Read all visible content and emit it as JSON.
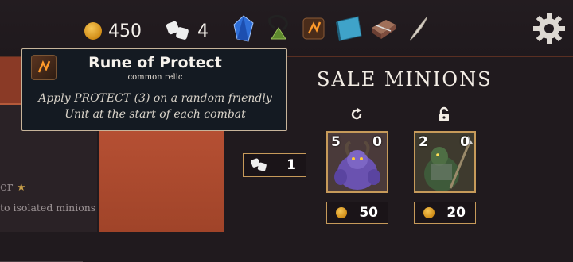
{
  "resources": {
    "gold": "450",
    "dice": "4"
  },
  "relics": [
    "blue-crystal-icon",
    "pendant-icon",
    "rune-of-protect-icon",
    "blue-tome-icon",
    "chest-icon",
    "feather-icon"
  ],
  "tooltip": {
    "title": "Rune of Protect",
    "subtitle": "common relic",
    "line1": "Apply PROTECT (3) on a random friendly",
    "line2": "Unit at the start of each combat"
  },
  "left_panel": {
    "name_partial": "er",
    "text_partial": "to isolated minions"
  },
  "sale": {
    "title": "SALE MINIONS",
    "reroll_cost": "1",
    "minions": [
      {
        "attack": "5",
        "defense": "0",
        "price": "50",
        "top_icon": "refresh-icon",
        "art": "purple-demon"
      },
      {
        "attack": "2",
        "defense": "0",
        "price": "20",
        "top_icon": "lock-open-icon",
        "art": "armored-lizard-warrior"
      }
    ]
  },
  "colors": {
    "gold": "#e0a12a",
    "frame_border": "#c69a5a",
    "tooltip_bg": "#141a22",
    "orange_panel": "#b14d31"
  }
}
